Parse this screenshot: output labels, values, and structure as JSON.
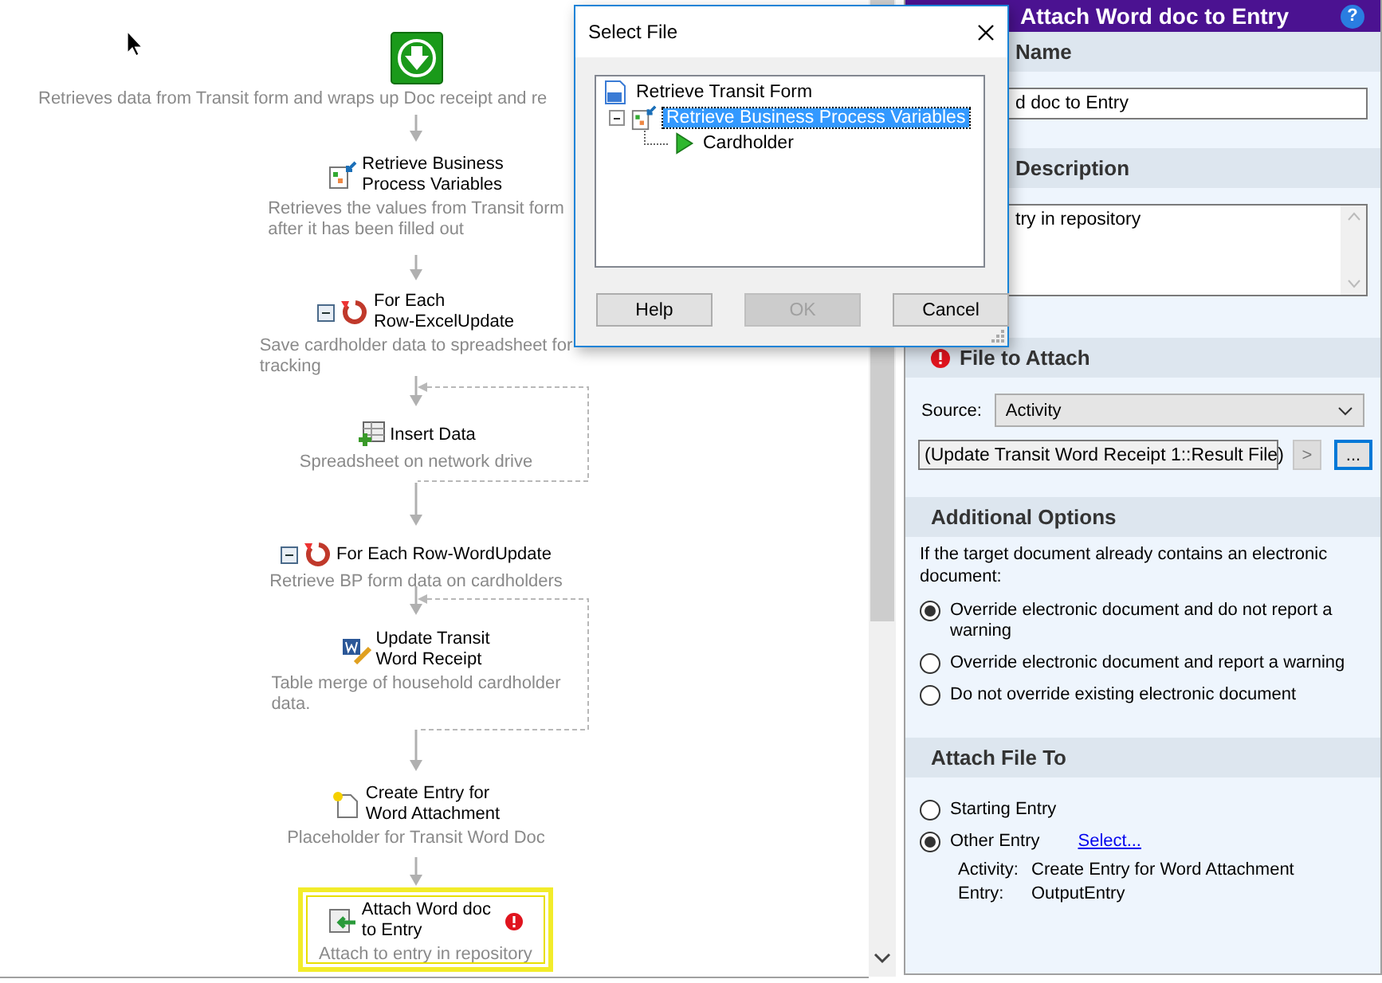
{
  "workflow": {
    "nodes": [
      {
        "kind": "start",
        "selected": false,
        "error": false,
        "description": "Retrieves data from Transit form and wraps up Doc receipt and re"
      },
      {
        "kind": "retrieve",
        "selected": false,
        "error": false,
        "title": "Retrieve Business\nProcess Variables",
        "description": "Retrieves the values from Transit form\nafter it has been filled out"
      },
      {
        "kind": "loop",
        "selected": false,
        "error": false,
        "expanded": true,
        "title": "For Each\nRow-ExcelUpdate",
        "description": "Save cardholder data to spreadsheet for\ntracking"
      },
      {
        "kind": "insert",
        "selected": false,
        "error": false,
        "title": "Insert Data",
        "description": "Spreadsheet on network drive"
      },
      {
        "kind": "loop",
        "selected": false,
        "error": false,
        "expanded": true,
        "title": "For Each Row-WordUpdate",
        "description": "Retrieve BP form data on cardholders"
      },
      {
        "kind": "word",
        "selected": false,
        "error": false,
        "title": "Update Transit\nWord Receipt",
        "description": "Table merge of household cardholder\ndata."
      },
      {
        "kind": "create",
        "selected": false,
        "error": false,
        "title": "Create Entry for\nWord Attachment",
        "description": "Placeholder for Transit Word Doc"
      },
      {
        "kind": "attach",
        "selected": true,
        "error": true,
        "title": "Attach Word doc\nto Entry",
        "description": "Attach to entry in repository"
      }
    ]
  },
  "dialog": {
    "title": "Select File",
    "tree": [
      {
        "kind": "form",
        "label": "Retrieve Transit Form",
        "selected": false,
        "children": [
          {
            "kind": "retrieve",
            "label": "Retrieve Business Process Variables",
            "selected": true,
            "expanded": true,
            "children": [
              {
                "kind": "variable",
                "label": "Cardholder",
                "selected": false
              }
            ]
          }
        ]
      }
    ],
    "buttons": [
      {
        "label": "Help",
        "disabled": false
      },
      {
        "label": "OK",
        "disabled": true
      },
      {
        "label": "Cancel",
        "disabled": false
      }
    ]
  },
  "properties": {
    "title": "Attach Word doc to Entry",
    "help": "?",
    "name_section": {
      "header": "Name",
      "value": "d doc to Entry"
    },
    "description_section": {
      "header": "Description",
      "value": "try in repository"
    },
    "file_section": {
      "header": "File to Attach",
      "error": true,
      "source_label": "Source:",
      "source_value": "Activity",
      "file_value": "(Update Transit Word Receipt 1::Result File)",
      "insert_button": ">",
      "browse_button": "..."
    },
    "options_section": {
      "header": "Additional Options",
      "intro": "If the target document already contains an electronic document:",
      "options": [
        {
          "label": "Override electronic document and do not report a warning",
          "selected": true
        },
        {
          "label": "Override electronic document and report a warning",
          "selected": false
        },
        {
          "label": "Do not override existing electronic document",
          "selected": false
        }
      ]
    },
    "attach_section": {
      "header": "Attach File To",
      "options": [
        {
          "label": "Starting Entry",
          "selected": false
        },
        {
          "label": "Other Entry",
          "selected": true,
          "link": "Select..."
        }
      ],
      "details": [
        {
          "label": "Activity:",
          "value": "Create Entry for Word Attachment"
        },
        {
          "label": "Entry:",
          "value": "OutputEntry"
        }
      ]
    }
  }
}
